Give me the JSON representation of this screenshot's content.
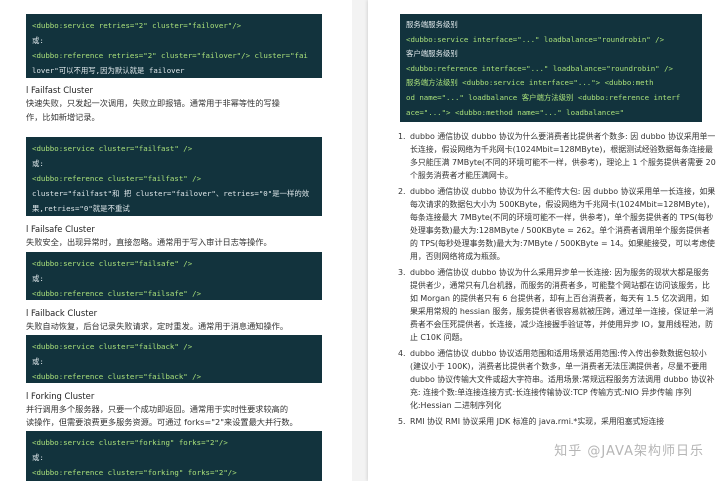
{
  "left": {
    "block1": [
      "<dubbo:service retries=\"2\" cluster=\"failover\"/>",
      "或:",
      "<dubbo:reference retries=\"2\" cluster=\"failover\"/> cluster=\"fai",
      "lover\"可以不用写,因为默认就是 failover"
    ],
    "failfast": {
      "title": "l Failfast Cluster",
      "desc1": "快速失败，只发起一次调用，失败立即报错。通常用于非幂等性的写操",
      "desc2": "作，比如新增记录。"
    },
    "block2": [
      "<dubbo:service cluster=\"failfast\" />",
      "或:",
      "<dubbo:reference cluster=\"failfast\" />",
      "cluster=\"failfast\"和 把 cluster=\"failover\"、retries=\"0\"是一样的效",
      "果,retries=\"0\"就是不重试"
    ],
    "failsafe": {
      "title": "l Failsafe Cluster",
      "desc1": "失败安全，出现异常时，直接忽略。通常用于写入审计日志等操作。"
    },
    "block3": [
      "<dubbo:service cluster=\"failsafe\" />",
      "或:",
      "<dubbo:reference cluster=\"failsafe\" />"
    ],
    "failback": {
      "title": "l Failback Cluster",
      "desc1": "失败自动恢复，后台记录失败请求，定时重发。通常用于消息通知操作。"
    },
    "block4": [
      "<dubbo:service cluster=\"failback\" />",
      "或:",
      "<dubbo:reference cluster=\"failback\" />"
    ],
    "forking": {
      "title": "l Forking Cluster",
      "desc1": "并行调用多个服务器，只要一个成功即返回。通常用于实时性要求较高的",
      "desc2": "读操作，但需要浪费更多服务资源。可通过 forks=\"2\"来设置最大并行数。"
    },
    "block5": [
      "<dubbo:service cluster=\"forking\" forks=\"2\"/>",
      "或:",
      "<dubbo:reference cluster=\"forking\" forks=\"2\"/>"
    ]
  },
  "right": {
    "code": [
      "服务端服务级别",
      "<dubbo:service interface=\"...\" loadbalance=\"roundrobin\" />",
      "客户端服务级别",
      "<dubbo:reference interface=\"...\" loadbalance=\"roundrobin\" />",
      "服务端方法级别 <dubbo:service interface=\"...\"> <dubbo:meth",
      "od name=\"...\" loadbalance 客户端方法级别 <dubbo:reference interf",
      "ace=\"...\"> <dubbo:method name=\"...\" loadbalance=\""
    ],
    "items": [
      {
        "num": "1.",
        "text": "dubbo 通信协议 dubbo 协议为什么要消费者比提供者个数多: 因 dubbo 协议采用单一长连接，假设网络为千兆网卡(1024Mbit=128MByte)，根据测试经验数据每条连接最多只能压满 7MByte(不同的环境可能不一样，供参考)，理论上 1 个服务提供者需要 20 个服务消费者才能压满网卡。"
      },
      {
        "num": "2.",
        "text": "dubbo 通信协议 dubbo 协议为什么不能传大包: 因 dubbo 协议采用单一长连接，如果每次请求的数据包大小为 500KByte，假设网络为千兆网卡(1024Mbit=128MByte)，每条连接最大 7MByte(不同的环境可能不一样，供参考)，单个服务提供者的 TPS(每秒处理事务数)最大为:128MByte / 500KByte = 262。单个消费者调用单个服务提供者的 TPS(每秒处理事务数)最大为:7MByte / 500KByte = 14。如果能接受，可以考虑使用，否则网络将成为瓶颈。"
      },
      {
        "num": "3.",
        "text": "dubbo 通信协议 dubbo 协议为什么采用异步单一长连接: 因为服务的现状大都是服务提供者少，通常只有几台机器，而服务的消费者多，可能整个网站都在访问该服务，比如 Morgan 的提供者只有 6 台提供者，却有上百台消费者，每天有 1.5 亿次调用，如果采用常规的 hessian 服务，服务提供者很容易就被压跨，通过单一连接，保证单一消费者不会压死提供者，长连接，减少连接握手验证等，并使用异步 IO，复用线程池，防止 C10K 问题。"
      },
      {
        "num": "4.",
        "text": "dubbo 通信协议 dubbo 协议适用范围和适用场景适用范围:传入传出参数数据包较小(建议小于 100K)，消费者比提供者个数多，单一消费者无法压满提供者，尽量不要用 dubbo 协议传输大文件或超大字符串。适用场景:常规远程服务方法调用 dubbo 协议补充: 连接个数:单连接连接方式:长连接传输协议:TCP 传输方式:NIO 异步传输 序列化:Hessian 二进制序列化"
      },
      {
        "num": "5.",
        "text": "RMI 协议 RMI 协议采用 JDK 标准的 java.rmi.*实现，采用阻塞式短连接"
      }
    ],
    "watermark": "知乎 @JAVA架构师日乐"
  }
}
